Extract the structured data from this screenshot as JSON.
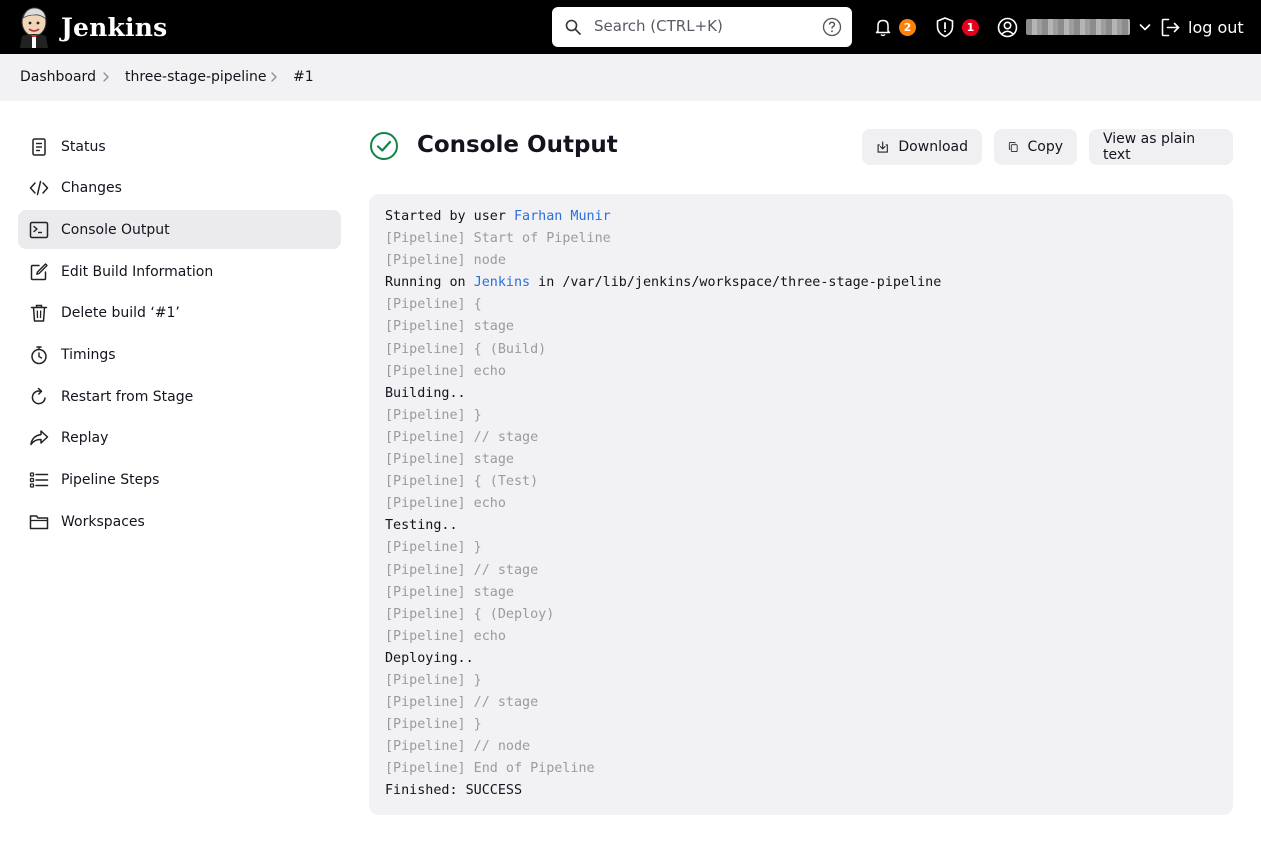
{
  "header": {
    "brand": "Jenkins",
    "search_placeholder": "Search (CTRL+K)",
    "notifications_count": "2",
    "security_count": "1",
    "logout_label": "log out"
  },
  "breadcrumb": [
    "Dashboard",
    "three-stage-pipeline",
    "#1"
  ],
  "sidebar": {
    "items": [
      {
        "label": "Status",
        "icon": "document-icon"
      },
      {
        "label": "Changes",
        "icon": "code-icon"
      },
      {
        "label": "Console Output",
        "icon": "terminal-icon",
        "active": true
      },
      {
        "label": "Edit Build Information",
        "icon": "edit-icon"
      },
      {
        "label": "Delete build ‘#1’",
        "icon": "trash-icon"
      },
      {
        "label": "Timings",
        "icon": "stopwatch-icon"
      },
      {
        "label": "Restart from Stage",
        "icon": "restart-icon"
      },
      {
        "label": "Replay",
        "icon": "replay-icon"
      },
      {
        "label": "Pipeline Steps",
        "icon": "list-icon"
      },
      {
        "label": "Workspaces",
        "icon": "folder-icon"
      }
    ]
  },
  "main": {
    "title": "Console Output",
    "buttons": {
      "download": "Download",
      "copy": "Copy",
      "plain": "View as plain text"
    }
  },
  "console": {
    "lines": [
      {
        "parts": [
          {
            "t": "Started by user ",
            "s": "normal"
          },
          {
            "t": "Farhan Munir",
            "s": "link"
          }
        ]
      },
      {
        "parts": [
          {
            "t": "[Pipeline] Start of Pipeline",
            "s": "muted"
          }
        ]
      },
      {
        "parts": [
          {
            "t": "[Pipeline] node",
            "s": "muted"
          }
        ]
      },
      {
        "parts": [
          {
            "t": "Running on ",
            "s": "normal"
          },
          {
            "t": "Jenkins",
            "s": "link"
          },
          {
            "t": " in /var/lib/jenkins/workspace/three-stage-pipeline",
            "s": "normal"
          }
        ]
      },
      {
        "parts": [
          {
            "t": "[Pipeline] {",
            "s": "muted"
          }
        ]
      },
      {
        "parts": [
          {
            "t": "[Pipeline] stage",
            "s": "muted"
          }
        ]
      },
      {
        "parts": [
          {
            "t": "[Pipeline] { (Build)",
            "s": "muted"
          }
        ]
      },
      {
        "parts": [
          {
            "t": "[Pipeline] echo",
            "s": "muted"
          }
        ]
      },
      {
        "parts": [
          {
            "t": "Building..",
            "s": "normal"
          }
        ]
      },
      {
        "parts": [
          {
            "t": "[Pipeline] }",
            "s": "muted"
          }
        ]
      },
      {
        "parts": [
          {
            "t": "[Pipeline] // stage",
            "s": "muted"
          }
        ]
      },
      {
        "parts": [
          {
            "t": "[Pipeline] stage",
            "s": "muted"
          }
        ]
      },
      {
        "parts": [
          {
            "t": "[Pipeline] { (Test)",
            "s": "muted"
          }
        ]
      },
      {
        "parts": [
          {
            "t": "[Pipeline] echo",
            "s": "muted"
          }
        ]
      },
      {
        "parts": [
          {
            "t": "Testing..",
            "s": "normal"
          }
        ]
      },
      {
        "parts": [
          {
            "t": "[Pipeline] }",
            "s": "muted"
          }
        ]
      },
      {
        "parts": [
          {
            "t": "[Pipeline] // stage",
            "s": "muted"
          }
        ]
      },
      {
        "parts": [
          {
            "t": "[Pipeline] stage",
            "s": "muted"
          }
        ]
      },
      {
        "parts": [
          {
            "t": "[Pipeline] { (Deploy)",
            "s": "muted"
          }
        ]
      },
      {
        "parts": [
          {
            "t": "[Pipeline] echo",
            "s": "muted"
          }
        ]
      },
      {
        "parts": [
          {
            "t": "Deploying..",
            "s": "normal"
          }
        ]
      },
      {
        "parts": [
          {
            "t": "[Pipeline] }",
            "s": "muted"
          }
        ]
      },
      {
        "parts": [
          {
            "t": "[Pipeline] // stage",
            "s": "muted"
          }
        ]
      },
      {
        "parts": [
          {
            "t": "[Pipeline] }",
            "s": "muted"
          }
        ]
      },
      {
        "parts": [
          {
            "t": "[Pipeline] // node",
            "s": "muted"
          }
        ]
      },
      {
        "parts": [
          {
            "t": "[Pipeline] End of Pipeline",
            "s": "muted"
          }
        ]
      },
      {
        "parts": [
          {
            "t": "Finished: SUCCESS",
            "s": "normal"
          }
        ]
      }
    ]
  },
  "colors": {
    "header_bg": "#000000",
    "link": "#2a6fdb",
    "success": "#138347",
    "badge_orange": "#fe820a",
    "badge_red": "#e6001f"
  }
}
